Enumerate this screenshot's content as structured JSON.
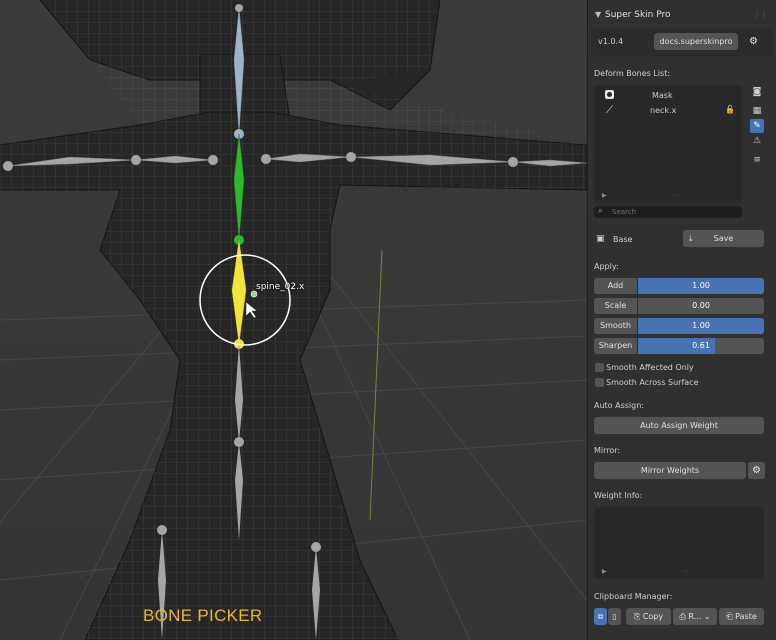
{
  "viewport": {
    "active_bone_label": "spine_02.x",
    "tool_label": "BONE PICKER",
    "tool_label_color": "#e8b638",
    "active_bone_color": "#f2e43a",
    "parent_bone_color": "#2db82d",
    "inactive_bone_color": "#9a9a9a"
  },
  "panel": {
    "title": "Super Skin Pro",
    "version": "v1.0.4",
    "docs_button": "docs.superskinpro",
    "deform_bones_label": "Deform Bones List:",
    "bones": [
      {
        "name": "Mask",
        "icon": "mask-icon"
      },
      {
        "name": "neck.x",
        "icon": "bone-icon",
        "lock": "lock-icon"
      }
    ],
    "search_placeholder": "Search",
    "base_label": "Base",
    "save_label": "Save",
    "apply_label": "Apply:",
    "sliders": [
      {
        "name": "Add",
        "value": "1.00",
        "fill": 1.0
      },
      {
        "name": "Scale",
        "value": "0.00",
        "fill": 0.0
      },
      {
        "name": "Smooth",
        "value": "1.00",
        "fill": 1.0
      },
      {
        "name": "Sharpen",
        "value": "0.61",
        "fill": 0.61
      }
    ],
    "checkboxes": [
      {
        "label": "Smooth Affected Only",
        "checked": false
      },
      {
        "label": "Smooth Across Surface",
        "checked": false
      }
    ],
    "auto_assign_label": "Auto Assign:",
    "auto_assign_button": "Auto Assign Weight",
    "mirror_label": "Mirror:",
    "mirror_button": "Mirror Weights",
    "weight_info_label": "Weight Info:",
    "clipboard_label": "Clipboard Manager:",
    "copy_label": "Copy",
    "mode_label": "R...",
    "paste_label": "Paste",
    "accent_color": "#4772b3"
  }
}
